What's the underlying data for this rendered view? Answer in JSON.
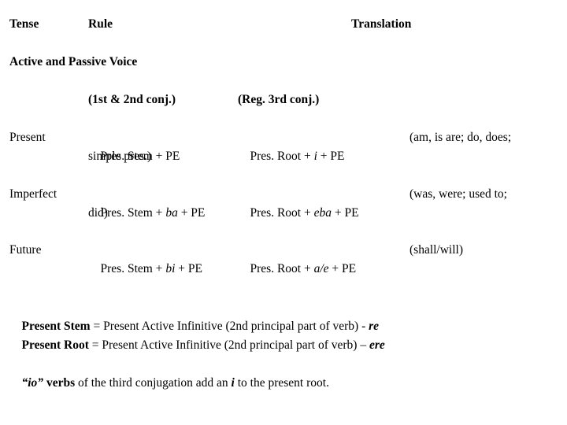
{
  "document": {
    "headers": {
      "tense": "Tense",
      "rule": "Rule",
      "translation": "Translation"
    },
    "section_heading": "Active and Passive Voice",
    "subheaders": {
      "col2": "(1st & 2nd conj.)",
      "col3": "(Reg. 3rd conj.)"
    },
    "rows": [
      {
        "tense": "Present",
        "rule_a_pre": "Pres. Stem + PE",
        "rule_a_italic": "",
        "rule_a_post": "",
        "rule_a_line2": "simple pres.)",
        "rule_b_pre": "Pres. Root + ",
        "rule_b_italic": "i",
        "rule_b_post": " + PE",
        "translation": "(am, is are; do, does;"
      },
      {
        "tense": "Imperfect",
        "rule_a_pre": "Pres. Stem + ",
        "rule_a_italic": "ba",
        "rule_a_post": " + PE",
        "rule_a_line2": "did)",
        "rule_b_pre": "Pres. Root + ",
        "rule_b_italic": "eba",
        "rule_b_post": " + PE",
        "translation": "(was, were; used to;"
      },
      {
        "tense": "Future",
        "rule_a_pre": "Pres. Stem + ",
        "rule_a_italic": "bi",
        "rule_a_post": " + PE",
        "rule_a_line2": "",
        "rule_b_pre": "Pres. Root + ",
        "rule_b_italic": "a/e",
        "rule_b_post": " + PE",
        "translation": "(shall/will)"
      }
    ],
    "notes": {
      "stem_label": "Present Stem",
      "stem_body": " = Present Active Infinitive (2nd principal part of verb) - ",
      "stem_ending": "re",
      "root_label": "Present Root",
      "root_body": " = Present Active Infinitive (2nd principal part of verb) – ",
      "root_ending": "ere",
      "io_quoted": "“io”",
      "io_bold": " verbs",
      "io_body_1": " of the third conjugation add an ",
      "io_italic": "i",
      "io_body_2": " to the present root."
    }
  }
}
